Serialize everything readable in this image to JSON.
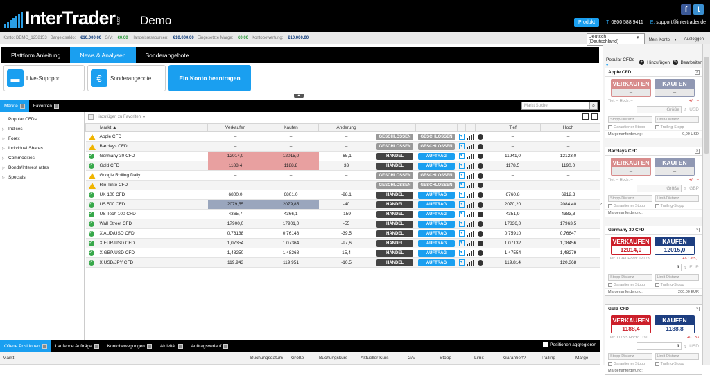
{
  "header": {
    "logo_text": "InterTrader",
    "logo_com": ".com",
    "demo": "Demo",
    "produkt": "Produkt",
    "phone_key": "T:",
    "phone": "0800 588 9411",
    "email_key": "E:",
    "email": "support@intertrader.de",
    "facebook": "f",
    "twitter": "t"
  },
  "account": {
    "konto_label": "Konto: DEMO_1258153",
    "bargeld_label": "Bargeldsaldo:",
    "bargeld": "€10.000,00",
    "gv_label": "G/V:",
    "gv": "€0,00",
    "handels_label": "Handelsressourcen:",
    "handels": "€10.000,00",
    "marge_label": "Eingesetzte Marge:",
    "marge": "€0,00",
    "bewertung_label": "Kontobewertung:",
    "bewertung": "€10.000,00",
    "language": "Deutsch (Deutschland)",
    "mein_konto": "Mein Konto",
    "logout": "Ausloggen"
  },
  "nav_tabs": [
    "Plattform Anleitung",
    "News & Analysen",
    "Sonderangebote"
  ],
  "tiles": {
    "support": "Live-Suppport",
    "offers": "Sonderangebote",
    "account": "Ein Konto beantragen"
  },
  "market_tabs": {
    "markets": "Märkte",
    "favorites": "Favoriten"
  },
  "search_placeholder": "Markt Suche",
  "add_favorite": "Hinzufügen zu Favoriten",
  "tree": [
    "Popular CFDs",
    "Indices",
    "Forex",
    "Individual Shares",
    "Commodities",
    "Bonds/Interest rates",
    "Specials"
  ],
  "table": {
    "headers": {
      "markt": "Markt ▲",
      "verkaufen": "Verkaufen",
      "kaufen": "Kaufen",
      "aenderung": "Änderung",
      "tief": "Tief",
      "hoch": "Hoch"
    },
    "rows": [
      {
        "name": "Apple CFD",
        "status": "warn",
        "sell": "–",
        "buy": "–",
        "chg": "–",
        "chg_class": "",
        "b1": "GESCHLOSSEN",
        "b2": "GESCHLOSSEN",
        "low": "–",
        "high": "–",
        "hl": ""
      },
      {
        "name": "Barclays CFD",
        "status": "warn",
        "sell": "–",
        "buy": "–",
        "chg": "–",
        "chg_class": "",
        "b1": "GESCHLOSSEN",
        "b2": "GESCHLOSSEN",
        "low": "–",
        "high": "–",
        "hl": ""
      },
      {
        "name": "Germany 30 CFD",
        "status": "ok",
        "sell": "12014,0",
        "buy": "12015,0",
        "chg": "-65,1",
        "chg_class": "neg",
        "b1": "HANDEL",
        "b2": "AUFTRAG",
        "low": "11941,0",
        "high": "12123,0",
        "hl": "red"
      },
      {
        "name": "Gold CFD",
        "status": "ok",
        "sell": "1188,4",
        "buy": "1188,8",
        "chg": "33",
        "chg_class": "pos",
        "b1": "HANDEL",
        "b2": "AUFTRAG",
        "low": "1178,5",
        "high": "1190,0",
        "hl": "red"
      },
      {
        "name": "Google Rolling Daily",
        "status": "warn",
        "sell": "–",
        "buy": "–",
        "chg": "–",
        "chg_class": "",
        "b1": "GESCHLOSSEN",
        "b2": "GESCHLOSSEN",
        "low": "–",
        "high": "–",
        "hl": ""
      },
      {
        "name": "Rio Tinto CFD",
        "status": "warn",
        "sell": "–",
        "buy": "–",
        "chg": "–",
        "chg_class": "",
        "b1": "GESCHLOSSEN",
        "b2": "GESCHLOSSEN",
        "low": "–",
        "high": "–",
        "hl": ""
      },
      {
        "name": "UK 100 CFD",
        "status": "ok",
        "sell": "6800,0",
        "buy": "6801,0",
        "chg": "-98,1",
        "chg_class": "neg",
        "b1": "HANDEL",
        "b2": "AUFTRAG",
        "low": "6760,8",
        "high": "6912,3",
        "hl": ""
      },
      {
        "name": "US 500 CFD",
        "status": "ok",
        "sell": "2079,55",
        "buy": "2079,85",
        "chg": "-40",
        "chg_class": "neg",
        "b1": "HANDEL",
        "b2": "AUFTRAG",
        "low": "2070,20",
        "high": "2084,40",
        "hl": "blu"
      },
      {
        "name": "US Tech 100 CFD",
        "status": "ok",
        "sell": "4365,7",
        "buy": "4366,1",
        "chg": "-159",
        "chg_class": "neg",
        "b1": "HANDEL",
        "b2": "AUFTRAG",
        "low": "4351,9",
        "high": "4383,3",
        "hl": ""
      },
      {
        "name": "Wall Street CFD",
        "status": "ok",
        "sell": "17900,0",
        "buy": "17901,0",
        "chg": "-55",
        "chg_class": "neg",
        "b1": "HANDEL",
        "b2": "AUFTRAG",
        "low": "17836,0",
        "high": "17963,5",
        "hl": ""
      },
      {
        "name": "X AUD/USD CFD",
        "status": "ok",
        "sell": "0,76138",
        "buy": "0,76148",
        "chg": "-39,5",
        "chg_class": "neg",
        "b1": "HANDEL",
        "b2": "AUFTRAG",
        "low": "0,75910",
        "high": "0,76647",
        "hl": ""
      },
      {
        "name": "X EUR/USD CFD",
        "status": "ok",
        "sell": "1,07354",
        "buy": "1,07364",
        "chg": "-97,6",
        "chg_class": "neg",
        "b1": "HANDEL",
        "b2": "AUFTRAG",
        "low": "1,07132",
        "high": "1,08456",
        "hl": ""
      },
      {
        "name": "X GBP/USD CFD",
        "status": "ok",
        "sell": "1,48250",
        "buy": "1,48268",
        "chg": "15,4",
        "chg_class": "pos",
        "b1": "HANDEL",
        "b2": "AUFTRAG",
        "low": "1,47554",
        "high": "1,48279",
        "hl": ""
      },
      {
        "name": "X USD/JPY CFD",
        "status": "ok",
        "sell": "119,943",
        "buy": "119,951",
        "chg": "-10,5",
        "chg_class": "neg",
        "b1": "HANDEL",
        "b2": "AUFTRAG",
        "low": "119,814",
        "high": "120,368",
        "hl": ""
      }
    ]
  },
  "bottom_tabs": [
    "Offene Positionen",
    "Laufende Aufträge",
    "Kontobewegungen",
    "Aktivität",
    "Auftragsverlauf"
  ],
  "aggregate": "Positionen aggregieren",
  "positions_headers": [
    "Markt",
    "Buchungsdatum",
    "Größe",
    "Buchungskurs",
    "Aktueller Kurs",
    "G/V",
    "Stopp",
    "Limit",
    "Garantiert?",
    "Trailing",
    "Marge"
  ],
  "right": {
    "popular": "Popular CFDs",
    "add": "Hinzufügen",
    "edit": "Bearbeiten",
    "sell": "VERKAUFEN",
    "buy": "KAUFEN",
    "stop": "Stopp-Distanz",
    "limit": "Limit-Distanz",
    "guaranteed": "Garantierter Stopp",
    "trailing": "Trailing-Stopp",
    "margin": "Margenanforderung:",
    "size": "Größe",
    "cards": [
      {
        "title": "Apple CFD",
        "active": false,
        "sell": "–",
        "buy": "–",
        "th": "Tief: – Hoch: –",
        "chg": "+/- : –",
        "qty": "Größe",
        "ccy": "USD",
        "margin": "0,00 USD"
      },
      {
        "title": "Barclays CFD",
        "active": false,
        "sell": "–",
        "buy": "–",
        "th": "Tief: – Hoch: –",
        "chg": "+/- : –",
        "qty": "Größe",
        "ccy": "GBP",
        "margin": ""
      },
      {
        "title": "Germany 30 CFD",
        "active": true,
        "sell": "12014,0",
        "buy": "12015,0",
        "th": "Tief: 11941 Hoch: 12123",
        "chg": "+/- : -65,1",
        "qty": "1",
        "ccy": "EUR",
        "margin": "200,00 EUR"
      },
      {
        "title": "Gold CFD",
        "active": true,
        "sell": "1188,4",
        "buy": "1188,8",
        "th": "Tief: 1178,5 Hoch: 1190",
        "chg": "+/- : 33",
        "qty": "1",
        "ccy": "USD",
        "margin": ""
      }
    ]
  },
  "colors": {
    "accent": "#1a9ff0",
    "sell": "#cc1f2a",
    "buy": "#1d3e80",
    "ok": "#37a84a",
    "warn": "#f0b400"
  }
}
